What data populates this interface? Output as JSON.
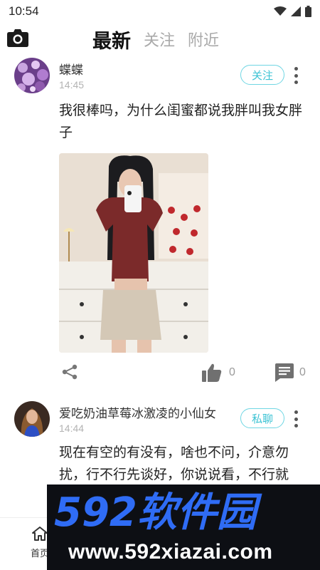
{
  "status_bar": {
    "time": "10:54"
  },
  "top_nav": {
    "tabs": [
      {
        "label": "最新",
        "active": true
      },
      {
        "label": "关注",
        "active": false
      },
      {
        "label": "附近",
        "active": false
      }
    ]
  },
  "posts": [
    {
      "author": "蝶蝶",
      "time": "14:45",
      "action_label": "关注",
      "text": "我很棒吗，为什么闺蜜都说我胖叫我女胖子",
      "likes": "0",
      "comments": "0"
    },
    {
      "author": "爱吃奶油草莓冰激凌的小仙女",
      "time": "14:44",
      "action_label": "私聊",
      "text": "现在有空的有没有，啥也不问，介意勿扰，行不行先谈好，你说说看，不行就"
    }
  ],
  "bottom_tabbar": {
    "home_label": "首页"
  },
  "watermark": {
    "logo_text": "592软件园",
    "url": "www.592xiazai.com"
  },
  "colors": {
    "accent": "#3cc3d4",
    "watermark_blue": "#2f6cf5"
  },
  "icons": [
    "camera-icon",
    "wifi-icon",
    "signal-icon",
    "battery-icon",
    "share-icon",
    "thumb-up-icon",
    "comment-icon",
    "more-vertical-icon",
    "home-icon"
  ]
}
